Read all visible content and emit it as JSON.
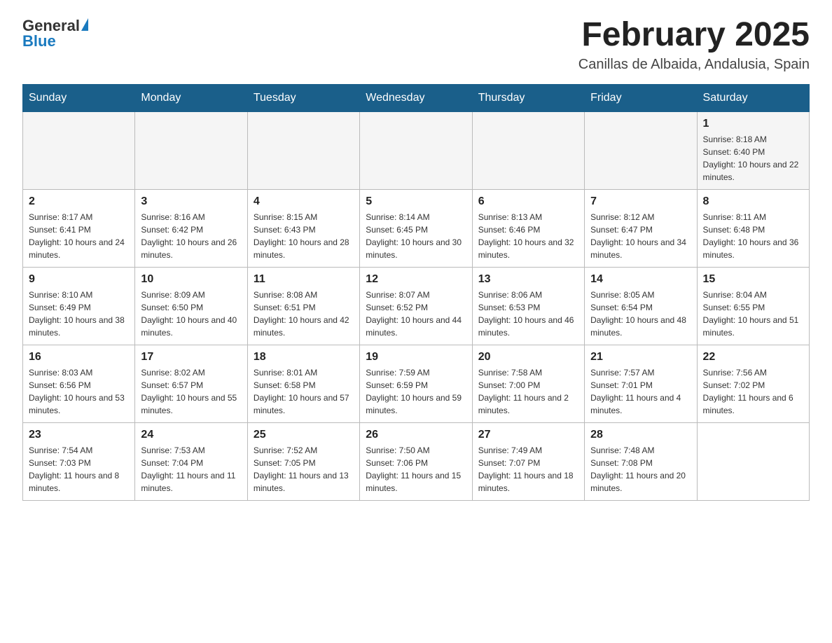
{
  "header": {
    "logo": {
      "general": "General",
      "blue": "Blue"
    },
    "title": "February 2025",
    "subtitle": "Canillas de Albaida, Andalusia, Spain"
  },
  "weekdays": [
    "Sunday",
    "Monday",
    "Tuesday",
    "Wednesday",
    "Thursday",
    "Friday",
    "Saturday"
  ],
  "weeks": [
    [
      {
        "day": "",
        "info": ""
      },
      {
        "day": "",
        "info": ""
      },
      {
        "day": "",
        "info": ""
      },
      {
        "day": "",
        "info": ""
      },
      {
        "day": "",
        "info": ""
      },
      {
        "day": "",
        "info": ""
      },
      {
        "day": "1",
        "info": "Sunrise: 8:18 AM\nSunset: 6:40 PM\nDaylight: 10 hours and 22 minutes."
      }
    ],
    [
      {
        "day": "2",
        "info": "Sunrise: 8:17 AM\nSunset: 6:41 PM\nDaylight: 10 hours and 24 minutes."
      },
      {
        "day": "3",
        "info": "Sunrise: 8:16 AM\nSunset: 6:42 PM\nDaylight: 10 hours and 26 minutes."
      },
      {
        "day": "4",
        "info": "Sunrise: 8:15 AM\nSunset: 6:43 PM\nDaylight: 10 hours and 28 minutes."
      },
      {
        "day": "5",
        "info": "Sunrise: 8:14 AM\nSunset: 6:45 PM\nDaylight: 10 hours and 30 minutes."
      },
      {
        "day": "6",
        "info": "Sunrise: 8:13 AM\nSunset: 6:46 PM\nDaylight: 10 hours and 32 minutes."
      },
      {
        "day": "7",
        "info": "Sunrise: 8:12 AM\nSunset: 6:47 PM\nDaylight: 10 hours and 34 minutes."
      },
      {
        "day": "8",
        "info": "Sunrise: 8:11 AM\nSunset: 6:48 PM\nDaylight: 10 hours and 36 minutes."
      }
    ],
    [
      {
        "day": "9",
        "info": "Sunrise: 8:10 AM\nSunset: 6:49 PM\nDaylight: 10 hours and 38 minutes."
      },
      {
        "day": "10",
        "info": "Sunrise: 8:09 AM\nSunset: 6:50 PM\nDaylight: 10 hours and 40 minutes."
      },
      {
        "day": "11",
        "info": "Sunrise: 8:08 AM\nSunset: 6:51 PM\nDaylight: 10 hours and 42 minutes."
      },
      {
        "day": "12",
        "info": "Sunrise: 8:07 AM\nSunset: 6:52 PM\nDaylight: 10 hours and 44 minutes."
      },
      {
        "day": "13",
        "info": "Sunrise: 8:06 AM\nSunset: 6:53 PM\nDaylight: 10 hours and 46 minutes."
      },
      {
        "day": "14",
        "info": "Sunrise: 8:05 AM\nSunset: 6:54 PM\nDaylight: 10 hours and 48 minutes."
      },
      {
        "day": "15",
        "info": "Sunrise: 8:04 AM\nSunset: 6:55 PM\nDaylight: 10 hours and 51 minutes."
      }
    ],
    [
      {
        "day": "16",
        "info": "Sunrise: 8:03 AM\nSunset: 6:56 PM\nDaylight: 10 hours and 53 minutes."
      },
      {
        "day": "17",
        "info": "Sunrise: 8:02 AM\nSunset: 6:57 PM\nDaylight: 10 hours and 55 minutes."
      },
      {
        "day": "18",
        "info": "Sunrise: 8:01 AM\nSunset: 6:58 PM\nDaylight: 10 hours and 57 minutes."
      },
      {
        "day": "19",
        "info": "Sunrise: 7:59 AM\nSunset: 6:59 PM\nDaylight: 10 hours and 59 minutes."
      },
      {
        "day": "20",
        "info": "Sunrise: 7:58 AM\nSunset: 7:00 PM\nDaylight: 11 hours and 2 minutes."
      },
      {
        "day": "21",
        "info": "Sunrise: 7:57 AM\nSunset: 7:01 PM\nDaylight: 11 hours and 4 minutes."
      },
      {
        "day": "22",
        "info": "Sunrise: 7:56 AM\nSunset: 7:02 PM\nDaylight: 11 hours and 6 minutes."
      }
    ],
    [
      {
        "day": "23",
        "info": "Sunrise: 7:54 AM\nSunset: 7:03 PM\nDaylight: 11 hours and 8 minutes."
      },
      {
        "day": "24",
        "info": "Sunrise: 7:53 AM\nSunset: 7:04 PM\nDaylight: 11 hours and 11 minutes."
      },
      {
        "day": "25",
        "info": "Sunrise: 7:52 AM\nSunset: 7:05 PM\nDaylight: 11 hours and 13 minutes."
      },
      {
        "day": "26",
        "info": "Sunrise: 7:50 AM\nSunset: 7:06 PM\nDaylight: 11 hours and 15 minutes."
      },
      {
        "day": "27",
        "info": "Sunrise: 7:49 AM\nSunset: 7:07 PM\nDaylight: 11 hours and 18 minutes."
      },
      {
        "day": "28",
        "info": "Sunrise: 7:48 AM\nSunset: 7:08 PM\nDaylight: 11 hours and 20 minutes."
      },
      {
        "day": "",
        "info": ""
      }
    ]
  ]
}
